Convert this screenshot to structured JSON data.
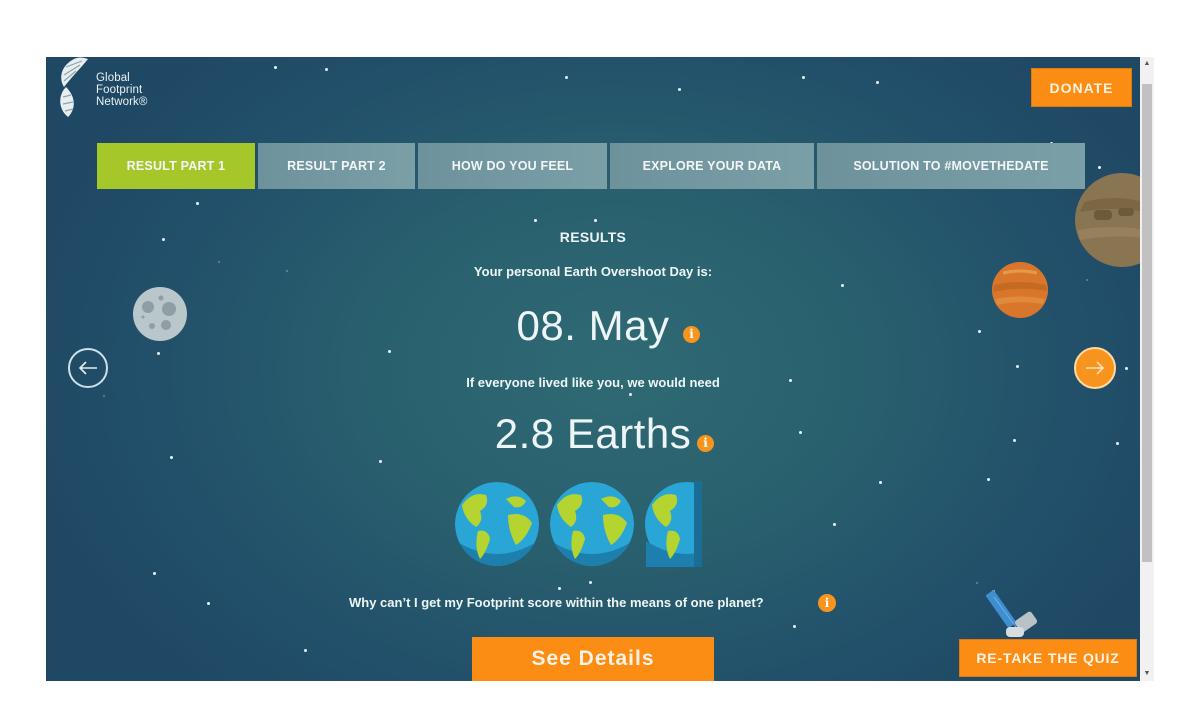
{
  "brand": {
    "logo_lines": [
      "Global",
      "Footprint",
      "Network®"
    ]
  },
  "header": {
    "donate_label": "DONATE"
  },
  "tabs": [
    {
      "label": "RESULT PART 1",
      "active": true
    },
    {
      "label": "RESULT PART 2",
      "active": false
    },
    {
      "label": "HOW DO YOU FEEL",
      "active": false
    },
    {
      "label": "EXPLORE YOUR DATA",
      "active": false
    },
    {
      "label": "SOLUTION TO #MOVETHEDATE",
      "active": false
    }
  ],
  "results": {
    "section_label": "RESULTS",
    "overshoot_label": "Your personal Earth Overshoot Day is:",
    "overshoot_date": "08. May",
    "need_label": "If everyone lived like you, we would need",
    "earths_value": "2.8 Earths",
    "earths_count": 2.8,
    "info_glyph": "i",
    "why_question": "Why can’t I get my Footprint score within the means of one planet?",
    "see_details_label": "See Details"
  },
  "footer": {
    "retake_label": "RE-TAKE THE QUIZ"
  },
  "navigation": {
    "prev_icon": "arrow-left-icon",
    "next_icon": "arrow-right-icon"
  },
  "colors": {
    "accent_orange": "#fb8c14",
    "active_tab_green": "#a6c72a",
    "inactive_tab": "#7497a1",
    "background_teal": "#2a5f6e"
  }
}
